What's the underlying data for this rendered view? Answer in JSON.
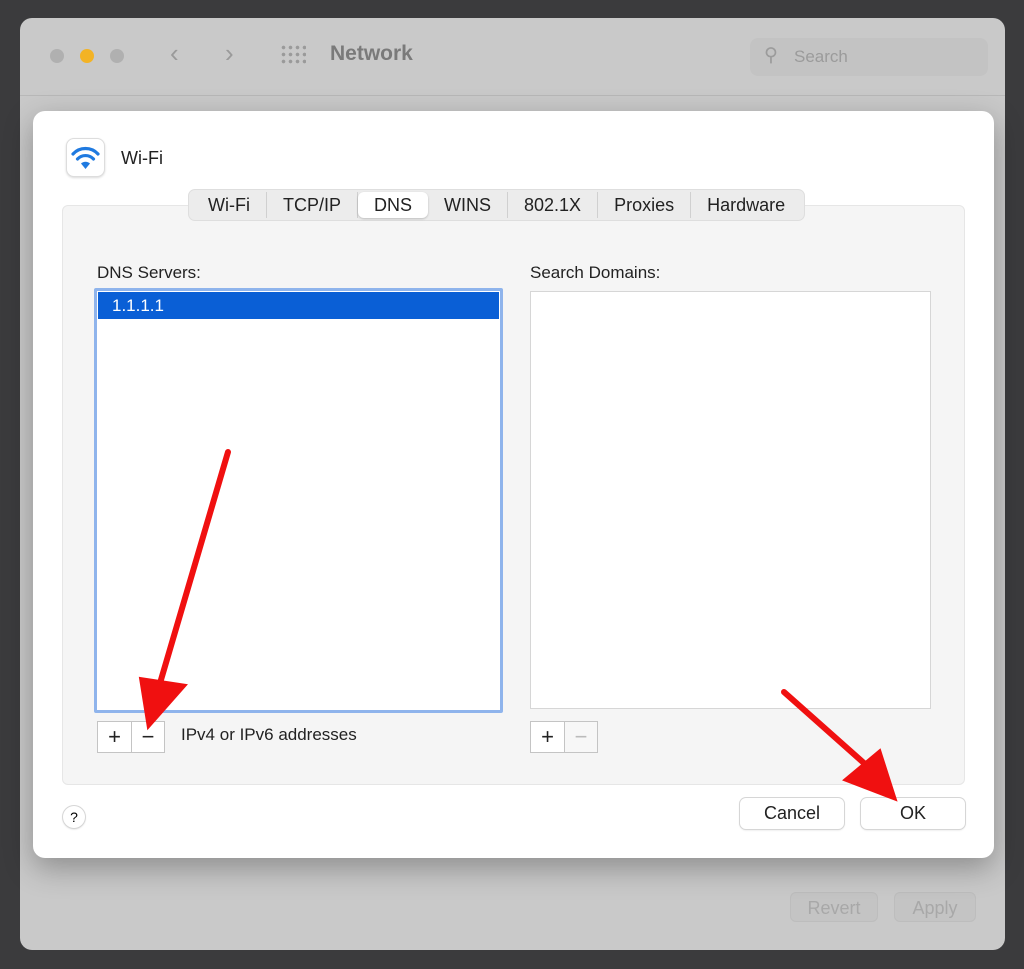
{
  "window": {
    "title": "Network",
    "search_placeholder": "Search",
    "revert_label": "Revert",
    "apply_label": "Apply"
  },
  "sheet": {
    "service_name": "Wi-Fi",
    "tabs": [
      {
        "label": "Wi-Fi"
      },
      {
        "label": "TCP/IP"
      },
      {
        "label": "DNS",
        "active": true
      },
      {
        "label": "WINS"
      },
      {
        "label": "802.1X"
      },
      {
        "label": "Proxies"
      },
      {
        "label": "Hardware"
      }
    ],
    "dns_servers": {
      "label": "DNS Servers:",
      "items": [
        "1.1.1.1"
      ],
      "hint": "IPv4 or IPv6 addresses"
    },
    "search_domains": {
      "label": "Search Domains:",
      "items": []
    },
    "add_label": "+",
    "remove_label": "−",
    "help_label": "?",
    "cancel_label": "Cancel",
    "ok_label": "OK"
  },
  "colors": {
    "accent": "#0a5fd6",
    "annotation_arrow": "#f01010",
    "wifi_icon": "#1f7ae0"
  }
}
